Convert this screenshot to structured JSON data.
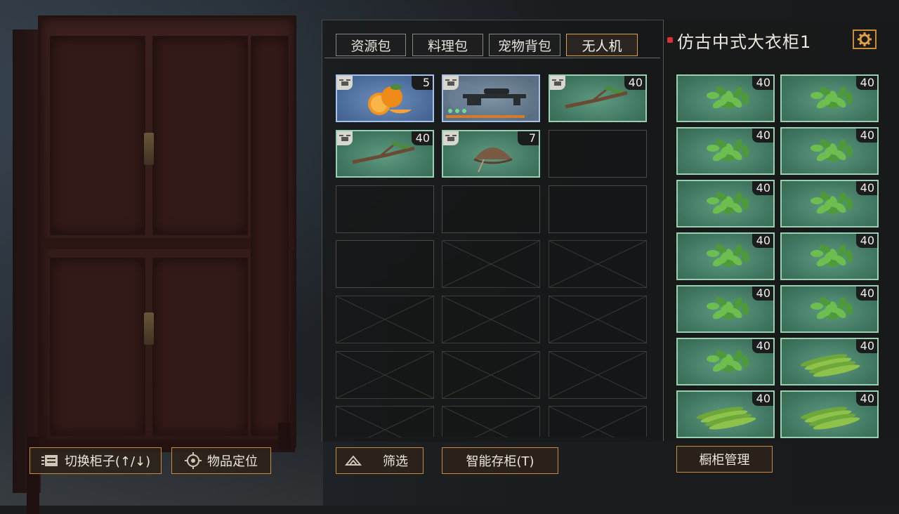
{
  "tabs": [
    {
      "label": "资源包",
      "active": false
    },
    {
      "label": "料理包",
      "active": false
    },
    {
      "label": "宠物背包",
      "active": false
    },
    {
      "label": "无人机",
      "active": true
    }
  ],
  "backpack": {
    "items": [
      {
        "name": "orange",
        "count": "5",
        "rarity": "blue",
        "icon": "orange-icon"
      },
      {
        "name": "sniper-rifle",
        "count": "",
        "rarity": "blue-grey",
        "icon": "sniper-rifle-icon"
      },
      {
        "name": "branch",
        "count": "40",
        "rarity": "green",
        "icon": "branch-icon"
      },
      {
        "name": "branch",
        "count": "40",
        "rarity": "green",
        "icon": "branch-icon"
      },
      {
        "name": "woven-hat",
        "count": "7",
        "rarity": "green",
        "icon": "straw-hat-icon"
      }
    ]
  },
  "cabinet": {
    "title": "仿古中式大衣柜1",
    "items": [
      {
        "count": "40",
        "icon": "leaves-icon"
      },
      {
        "count": "40",
        "icon": "leaves-icon"
      },
      {
        "count": "40",
        "icon": "leaves-icon"
      },
      {
        "count": "40",
        "icon": "leaves-icon"
      },
      {
        "count": "40",
        "icon": "leaves-icon"
      },
      {
        "count": "40",
        "icon": "leaves-icon"
      },
      {
        "count": "40",
        "icon": "leaves-icon"
      },
      {
        "count": "40",
        "icon": "leaves-icon"
      },
      {
        "count": "40",
        "icon": "leaves-icon"
      },
      {
        "count": "40",
        "icon": "leaves-icon"
      },
      {
        "count": "40",
        "icon": "leaves-icon"
      },
      {
        "count": "40",
        "icon": "long-leaves-icon"
      },
      {
        "count": "40",
        "icon": "long-leaves-icon"
      },
      {
        "count": "40",
        "icon": "long-leaves-icon"
      }
    ]
  },
  "buttons": {
    "switch_cabinet": "切换柜子(↑/↓)",
    "locate_item": "物品定位",
    "filter": "筛选",
    "smart_store": "智能存柜(T)",
    "cabinet_manage": "橱柜管理"
  },
  "colors": {
    "accent": "#c88a3c",
    "active_tab": "#d4a054",
    "green_slot": "#3f7560",
    "blue_slot": "#4a6a9a",
    "title_dot": "#d8313a"
  }
}
